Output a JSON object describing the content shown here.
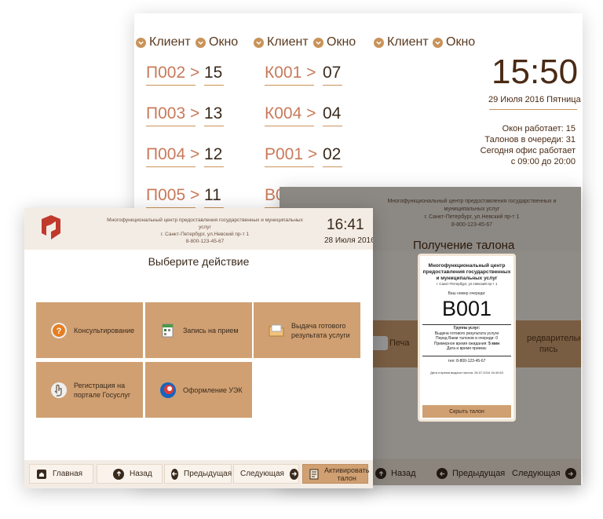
{
  "board": {
    "col_client": "Клиент",
    "col_window": "Окно",
    "queue": [
      [
        {
          "code": "П002 >",
          "window": "15"
        },
        {
          "code": "К001 >",
          "window": "07"
        }
      ],
      [
        {
          "code": "П003 >",
          "window": "13"
        },
        {
          "code": "К004 >",
          "window": "04"
        }
      ],
      [
        {
          "code": "П004 >",
          "window": "12"
        },
        {
          "code": "Р001 >",
          "window": "02"
        }
      ],
      [
        {
          "code": "П005 >",
          "window": "11"
        },
        {
          "code": "В0",
          "window": ""
        }
      ]
    ],
    "time": "15:50",
    "date": "29 Июля 2016 Пятница",
    "stats": [
      "Окон работает: 15",
      "Талонов в очереди: 31",
      "Сегодня офис работает",
      "с 09:00 до 20:00"
    ]
  },
  "ticket_screen": {
    "org": "Многофункциональный центр предоставления государственных и муниципальных услуг",
    "address": "г. Санкт-Петербург, ул.Невский пр-т 1",
    "phone": "8-800-123-45-67",
    "title": "Получение талона",
    "print_label": "Печа",
    "band_right": [
      "редварительная",
      "пись"
    ],
    "nav": {
      "back": "Назад",
      "prev": "Предыдущая",
      "next": "Следующая"
    },
    "ticket": {
      "org": "Многофункциональный центр предоставления государственных и муниципальных услуг",
      "address": "г. Санкт-Петербург, ул.Невский пр-т 1",
      "number_label": "Ваш номер очереди:",
      "number": "B001",
      "group_label": "Группа услуг:",
      "group_name": "Выдача готового результата услуги",
      "ahead": "Перед Вами талонов в очереди: 0",
      "wait_label": "Примерное время ожидания:",
      "wait_value": "5 мин",
      "datetime_label": "Дата и время приема:",
      "phone": "тел: 8-800-123-45-67",
      "issued": "Дата и время выдачи талона: 28.07.2016 16:40:53",
      "hide_button": "Скрыть талон"
    }
  },
  "kiosk": {
    "org": "Многофункциональный центр предоставления государственных и муниципальных услуг",
    "address": "г. Санкт-Петербург, ул.Невский пр-т 1",
    "phone": "8-800-123-45-67",
    "time": "16:41",
    "date": "28 Июля 2016",
    "title": "Выберите действие",
    "tiles": [
      {
        "line1": "Консультирование",
        "line2": ""
      },
      {
        "line1": "Запись на прием",
        "line2": ""
      },
      {
        "line1": "Выдача готового",
        "line2": "результата услуги"
      },
      {
        "line1": "Регистрация на",
        "line2": "портале Госуслуг"
      },
      {
        "line1": "Оформление УЭК",
        "line2": ""
      }
    ],
    "nav": {
      "home": "Главная",
      "back": "Назад",
      "prev": "Предыдущая",
      "next": "Следующая",
      "activate_line1": "Активировать",
      "activate_line2": "талон"
    },
    "colors": {
      "accent": "#d0a072",
      "header": "#f3ece4",
      "text": "#3a2a1c"
    }
  }
}
